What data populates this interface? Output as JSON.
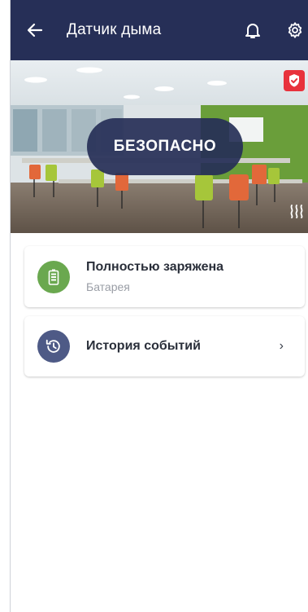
{
  "appbar": {
    "title": "Датчик дыма",
    "icons": [
      "back-arrow-icon",
      "bell-icon",
      "gear-icon"
    ]
  },
  "hero": {
    "status_label": "БЕЗОПАСНО",
    "badge_icon": "shield-check-icon",
    "heat_icon": "heat-waves-icon"
  },
  "battery": {
    "title": "Полностью заряжена",
    "subtitle": "Батарея",
    "icon": "battery-full-icon",
    "color": "#6aa84f"
  },
  "history": {
    "title": "История событий",
    "chevron": "›",
    "icon": "history-icon",
    "color": "#4e5a86"
  },
  "colors": {
    "appbar_bg": "#262f57",
    "alarm_red": "#e8323c"
  }
}
